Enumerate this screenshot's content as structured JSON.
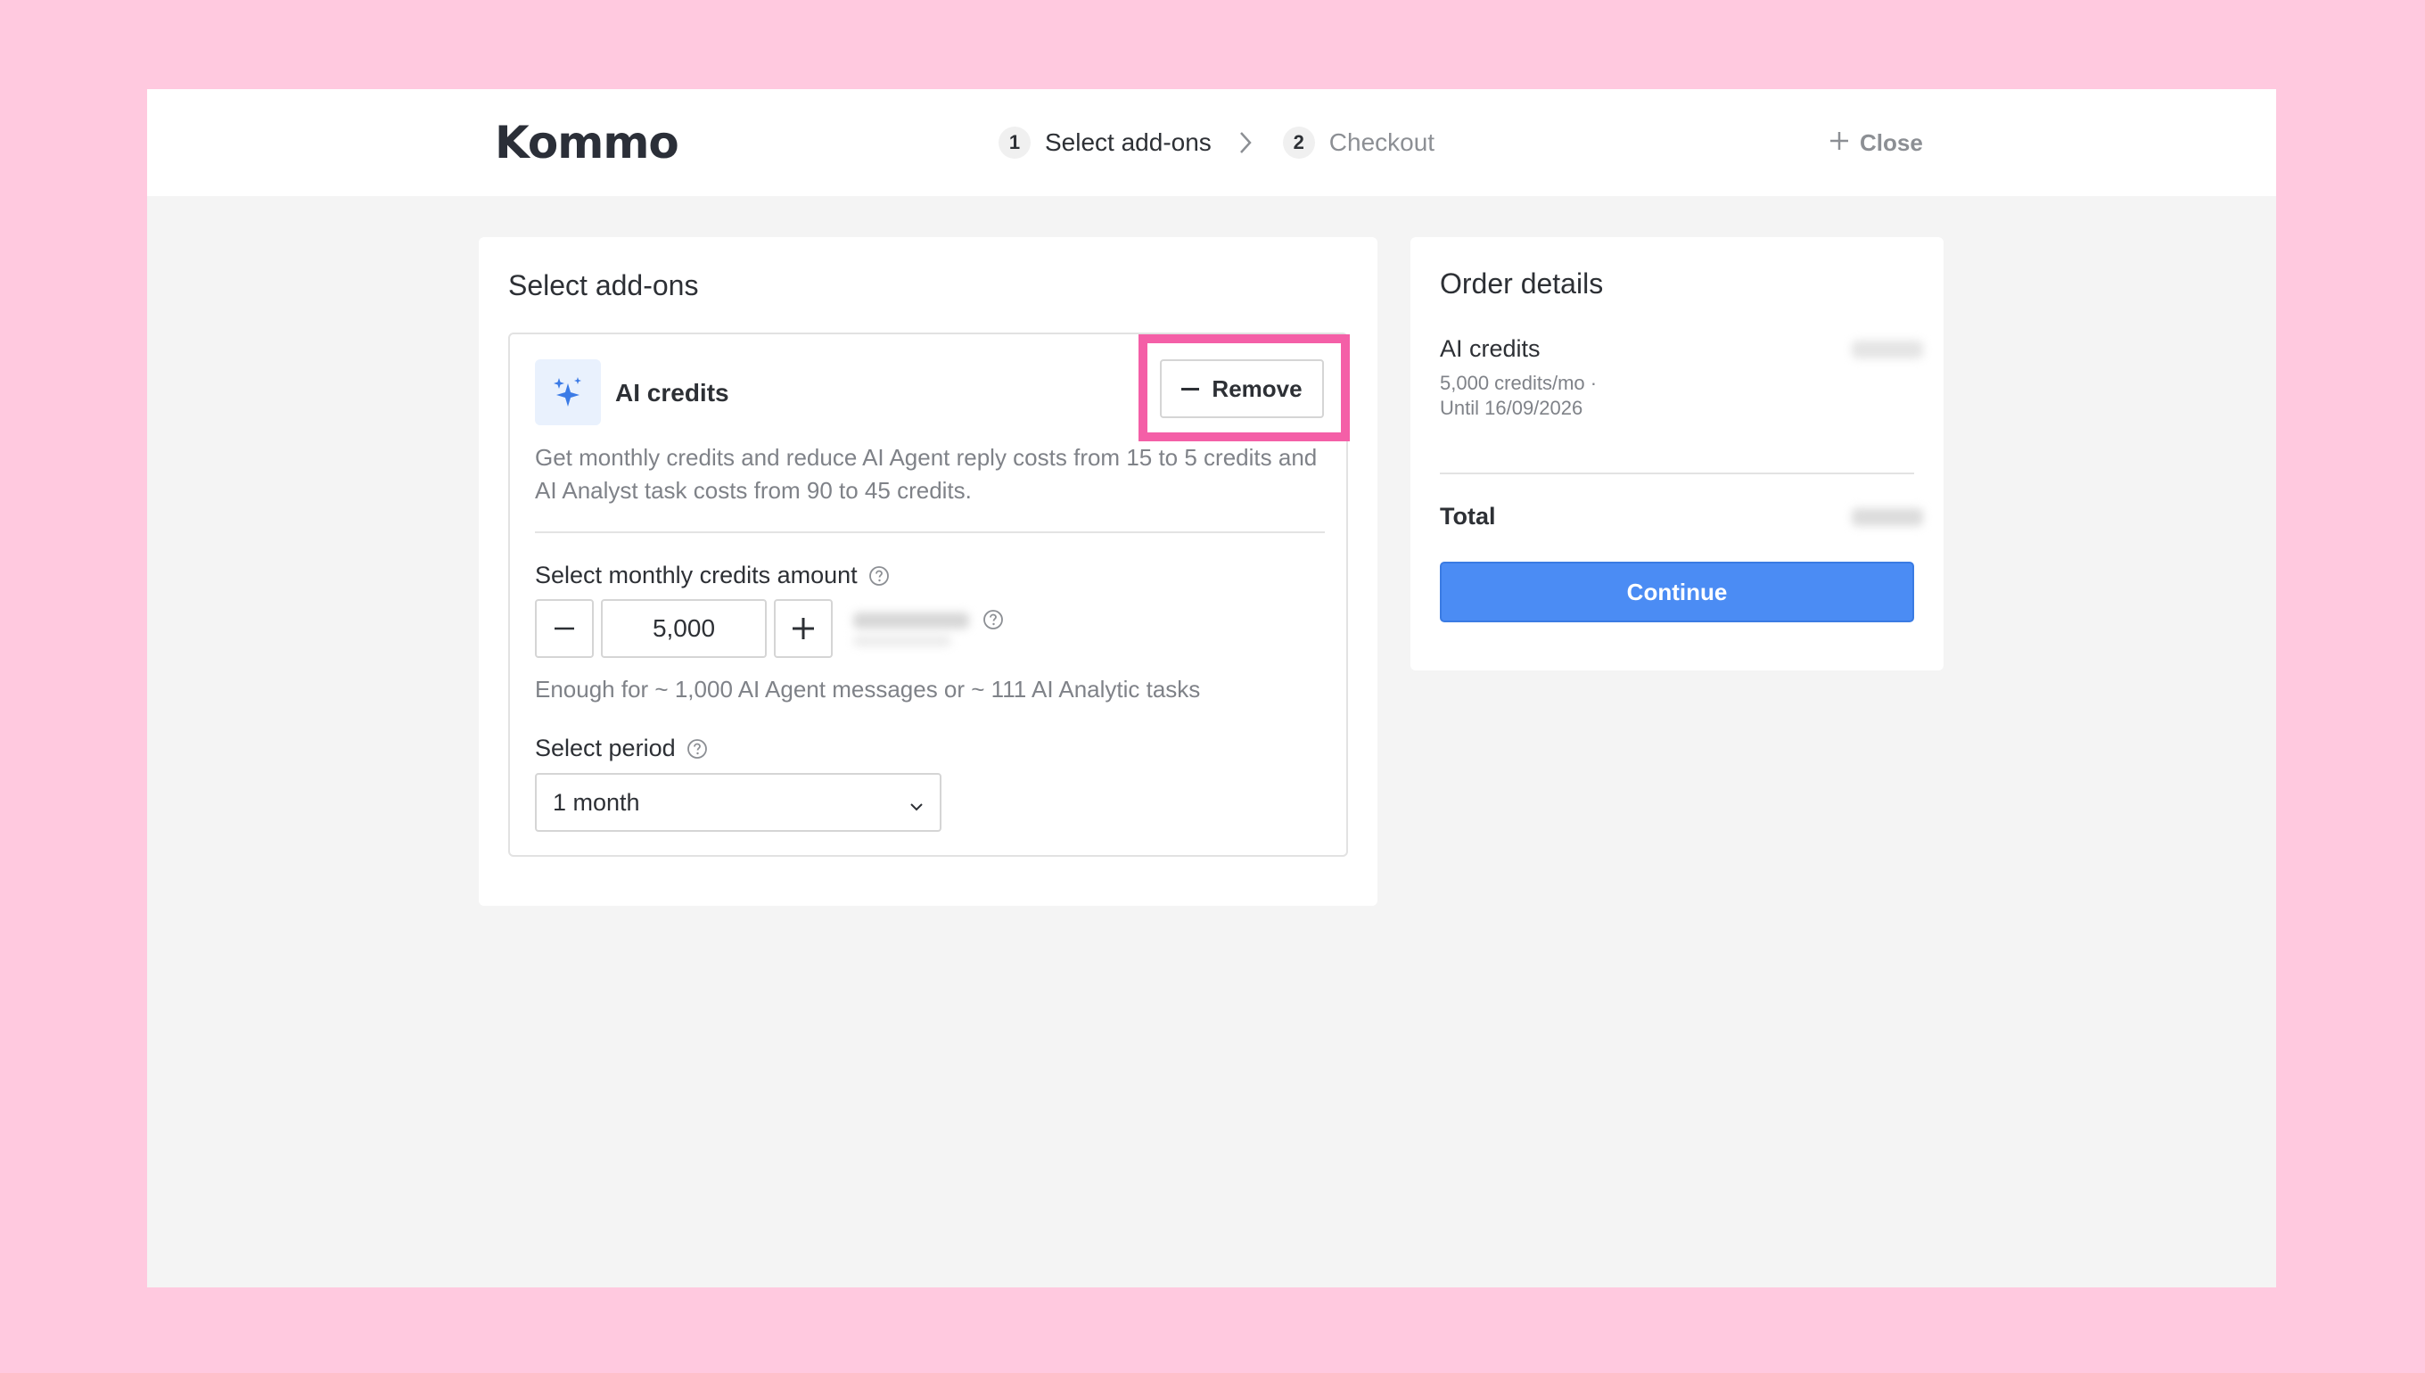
{
  "header": {
    "logo_text": "Kommo",
    "steps": [
      {
        "number": "1",
        "label": "Select add-ons"
      },
      {
        "number": "2",
        "label": "Checkout"
      }
    ],
    "close_label": "Close"
  },
  "addons": {
    "title": "Select add-ons",
    "item": {
      "name": "AI credits",
      "icon": "sparkles-icon",
      "remove_label": "Remove",
      "description": "Get monthly credits and reduce AI Agent reply costs from 15 to 5 credits and AI Analyst task costs from 90 to 45 credits.",
      "credits_label": "Select monthly credits amount",
      "credits_value": "5,000",
      "enough_text": "Enough for ~ 1,000 AI Agent messages or ~ 111 AI Analytic tasks",
      "period_label": "Select period",
      "period_value": "1 month"
    }
  },
  "order": {
    "title": "Order details",
    "item_name": "AI credits",
    "item_detail": "5,000 credits/mo ·",
    "item_until": "Until 16/09/2026",
    "total_label": "Total",
    "continue_label": "Continue"
  },
  "colors": {
    "background": "#ffc9df",
    "highlight": "#f45fa7",
    "accent": "#4b8cf4"
  }
}
